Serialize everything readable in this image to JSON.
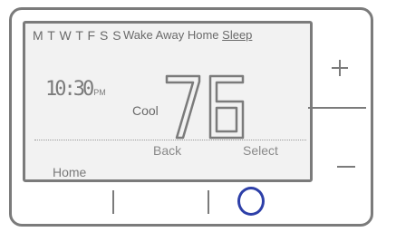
{
  "days": "M T W T F  S S",
  "modes": {
    "wake": "Wake",
    "away": "Away",
    "home": "Home",
    "sleep": "Sleep"
  },
  "clock": {
    "time": "10:30",
    "ampm": "PM"
  },
  "system_mode": "Cool",
  "temperature": "76",
  "buttons": {
    "back": "Back",
    "select": "Select",
    "home": "Home"
  },
  "colors": {
    "outline": "#7b7b7b",
    "accent_circle": "#2d3fa8",
    "screen_bg": "#f2f2f2"
  },
  "icons": {
    "plus": "plus-icon",
    "minus": "minus-icon",
    "circle": "circle-button-icon"
  }
}
